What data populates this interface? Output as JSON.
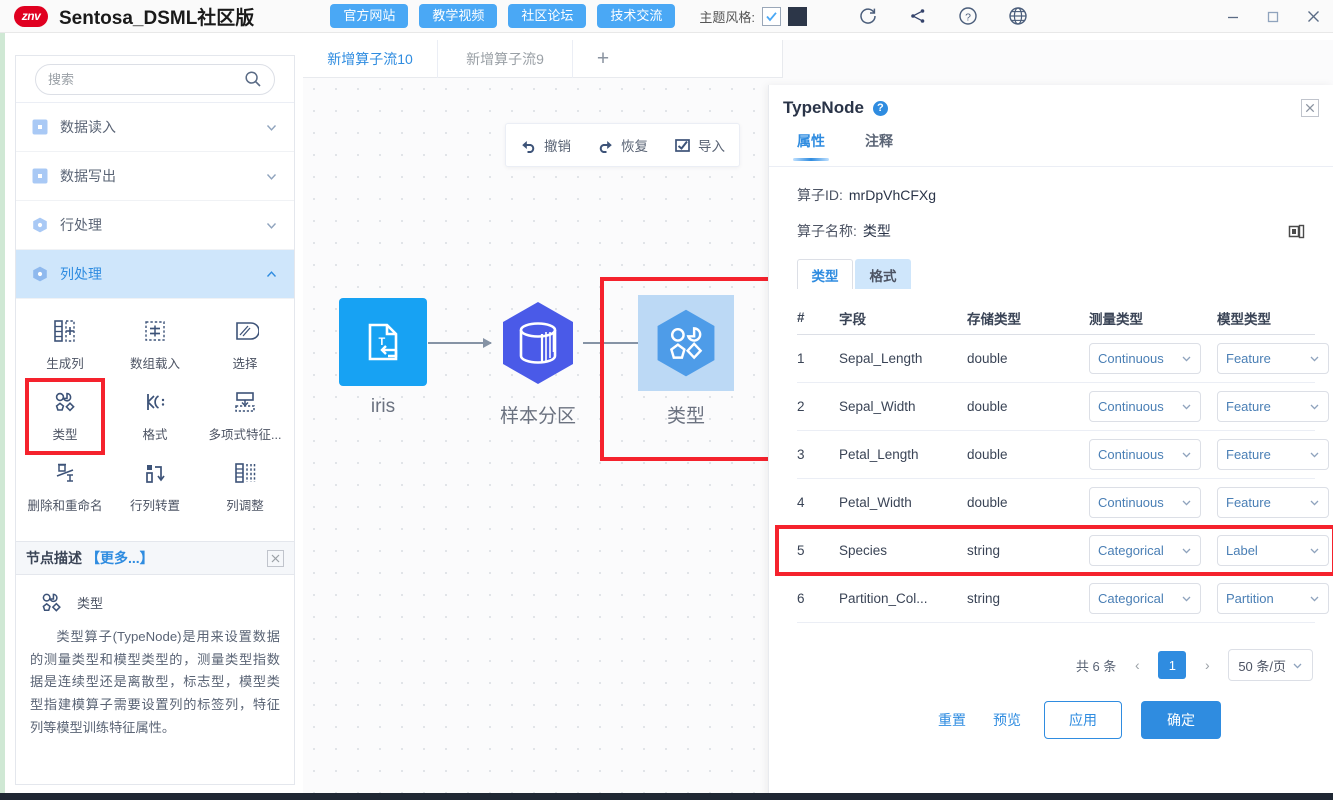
{
  "titlebar": {
    "logo_text": "znv",
    "app_title": "Sentosa_DSML社区版",
    "buttons": [
      {
        "label": "官方网站",
        "name": "official-website-button"
      },
      {
        "label": "教学视频",
        "name": "tutorial-video-button"
      },
      {
        "label": "社区论坛",
        "name": "community-forum-button"
      },
      {
        "label": "技术交流",
        "name": "tech-exchange-button"
      }
    ],
    "theme_label": "主题风格:",
    "theme_checked": true,
    "theme_color": "#2c3648",
    "icons": [
      "refresh-icon",
      "workflow-icon",
      "help-circle-icon",
      "globe-icon"
    ],
    "window_controls": [
      "minimize",
      "maximize",
      "close"
    ]
  },
  "sidebar": {
    "search": {
      "placeholder": "搜索",
      "value": ""
    },
    "categories": [
      {
        "label": "数据读入",
        "expanded": false,
        "name": "sidebar-category-data-input"
      },
      {
        "label": "数据写出",
        "expanded": false,
        "name": "sidebar-category-data-output"
      },
      {
        "label": "行处理",
        "expanded": false,
        "name": "sidebar-category-row-processing"
      },
      {
        "label": "列处理",
        "expanded": true,
        "name": "sidebar-category-column-processing"
      }
    ],
    "operators": [
      {
        "label": "生成列",
        "icon": "generate-column-icon",
        "highlight": false
      },
      {
        "label": "数组载入",
        "icon": "array-load-icon",
        "highlight": false
      },
      {
        "label": "选择",
        "icon": "select-icon",
        "highlight": false
      },
      {
        "label": "类型",
        "icon": "type-icon",
        "highlight": true
      },
      {
        "label": "格式",
        "icon": "format-icon",
        "highlight": false
      },
      {
        "label": "多项式特征...",
        "icon": "polynomial-feature-icon",
        "highlight": false
      },
      {
        "label": "删除和重命名",
        "icon": "delete-rename-icon",
        "highlight": false
      },
      {
        "label": "行列转置",
        "icon": "transpose-icon",
        "highlight": false
      },
      {
        "label": "列调整",
        "icon": "column-adjust-icon",
        "highlight": false
      }
    ],
    "description": {
      "header_title": "节点描述",
      "header_more": "【更多...】",
      "op_name": "类型",
      "body": "类型算子(TypeNode)是用来设置数据的测量类型和模型类型的，测量类型指数据是连续型还是离散型，标志型，模型类型指建模算子需要设置列的标签列，特征列等模型训练特征属性。"
    }
  },
  "canvas": {
    "tabs": [
      {
        "label": "新增算子流10",
        "active": true
      },
      {
        "label": "新增算子流9",
        "active": false
      }
    ],
    "add_tab_label": "+",
    "toolbar": [
      {
        "label": "撤销",
        "icon": "undo-icon"
      },
      {
        "label": "恢复",
        "icon": "redo-icon"
      },
      {
        "label": "导入",
        "icon": "import-icon"
      }
    ],
    "nodes": [
      {
        "label": "iris",
        "icon": "text-file-input-icon",
        "selected": false,
        "highlight": false
      },
      {
        "label": "样本分区",
        "icon": "database-partition-icon",
        "selected": false,
        "highlight": false
      },
      {
        "label": "类型",
        "icon": "type-node-icon",
        "selected": true,
        "highlight": true
      }
    ]
  },
  "panel": {
    "title": "TypeNode",
    "help_icon": "?",
    "close_icon": "×",
    "tabs": [
      {
        "label": "属性",
        "active": true
      },
      {
        "label": "注释",
        "active": false
      }
    ],
    "operator_id_key": "算子ID:",
    "operator_id_value": "mrDpVhCFXg",
    "operator_name_key": "算子名称:",
    "operator_name_value": "类型",
    "copy_icon": "copy-icon",
    "sub_tabs": [
      {
        "label": "类型",
        "active": true
      },
      {
        "label": "格式",
        "active": false
      }
    ],
    "table": {
      "headers": [
        "#",
        "字段",
        "存储类型",
        "测量类型",
        "模型类型"
      ],
      "rows": [
        {
          "idx": "1",
          "field": "Sepal_Length",
          "store": "double",
          "measure": "Continuous",
          "model": "Feature",
          "highlight": false
        },
        {
          "idx": "2",
          "field": "Sepal_Width",
          "store": "double",
          "measure": "Continuous",
          "model": "Feature",
          "highlight": false
        },
        {
          "idx": "3",
          "field": "Petal_Length",
          "store": "double",
          "measure": "Continuous",
          "model": "Feature",
          "highlight": false
        },
        {
          "idx": "4",
          "field": "Petal_Width",
          "store": "double",
          "measure": "Continuous",
          "model": "Feature",
          "highlight": false
        },
        {
          "idx": "5",
          "field": "Species",
          "store": "string",
          "measure": "Categorical",
          "model": "Label",
          "highlight": true
        },
        {
          "idx": "6",
          "field": "Partition_Col...",
          "store": "string",
          "measure": "Categorical",
          "model": "Partition",
          "highlight": false
        }
      ]
    },
    "pager": {
      "total_text": "共 6 条",
      "prev": "‹",
      "current_page": "1",
      "next": "›",
      "page_size": "50 条/页"
    },
    "footer": {
      "reset": "重置",
      "preview": "预览",
      "apply": "应用",
      "confirm": "确定"
    }
  },
  "colors": {
    "accent": "#2f8ce0",
    "toolbar_button": "#4aa8f5",
    "highlight_red": "#f5222d",
    "node_blue": "#17a2f3",
    "node_purple": "#4a5ae8",
    "selected_bg": "#bcd9f5"
  }
}
